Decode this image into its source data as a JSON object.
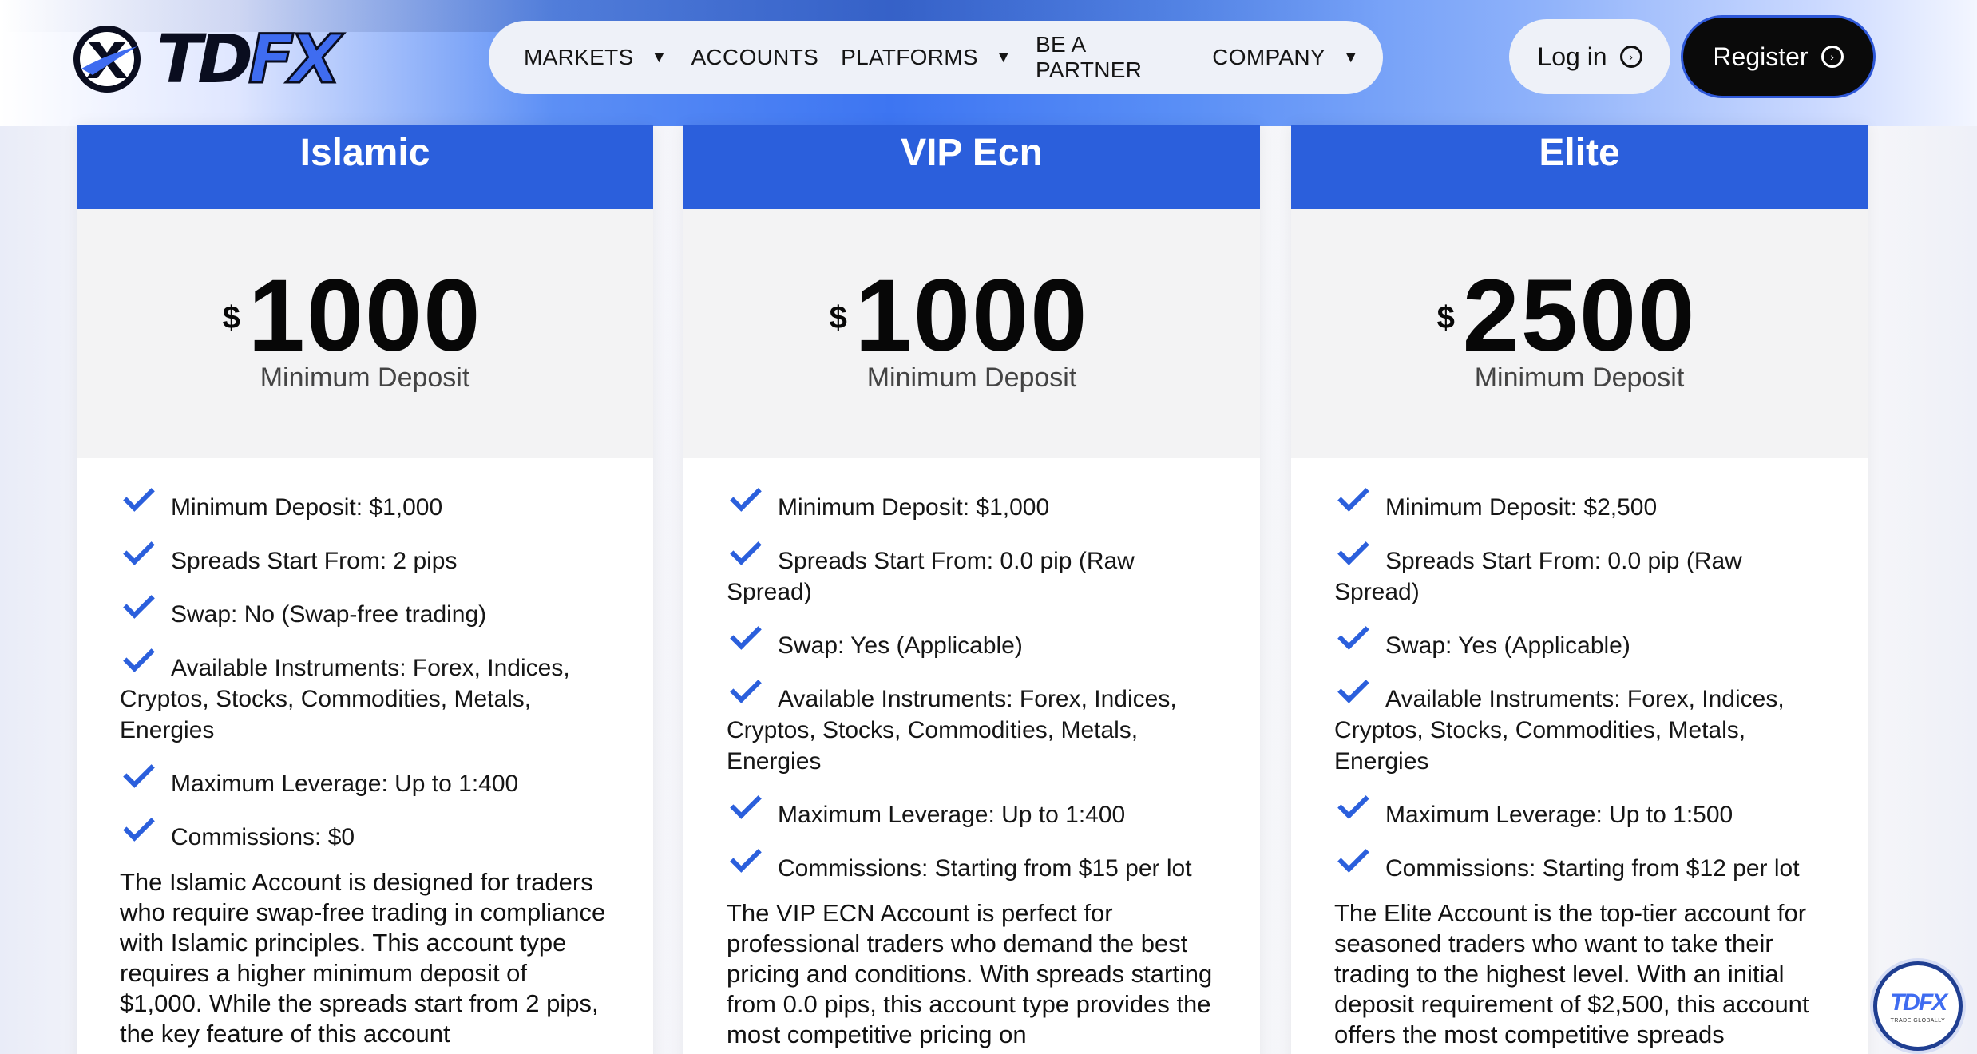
{
  "brand": {
    "logo_text_part1": "TD",
    "logo_text_part2": "FX",
    "accent_color": "#2b5fdc",
    "badge_sub": "TRADE GLOBALLY"
  },
  "nav": {
    "items": [
      {
        "label": "MARKETS",
        "has_dropdown": true
      },
      {
        "label": "ACCOUNTS",
        "has_dropdown": false
      },
      {
        "label": "PLATFORMS",
        "has_dropdown": true
      },
      {
        "label": "BE A PARTNER",
        "has_dropdown": false
      },
      {
        "label": "COMPANY",
        "has_dropdown": true
      }
    ],
    "login_label": "Log in",
    "register_label": "Register"
  },
  "cards": [
    {
      "title": "Islamic",
      "currency": "$",
      "amount": "1000",
      "amount_label": "Minimum Deposit",
      "features": [
        "Minimum Deposit: $1,000",
        "Spreads Start From: 2 pips",
        "Swap: No (Swap-free trading)",
        "Available Instruments: Forex, Indices, Cryptos, Stocks, Commodities, Metals, Energies",
        "Maximum Leverage: Up to 1:400",
        "Commissions: $0"
      ],
      "description": "The Islamic Account is designed for traders who require swap-free trading in compliance with Islamic principles. This account type requires a higher minimum deposit of $1,000. While the spreads start from 2 pips, the key feature of this account"
    },
    {
      "title": "VIP Ecn",
      "currency": "$",
      "amount": "1000",
      "amount_label": "Minimum Deposit",
      "features": [
        "Minimum Deposit: $1,000",
        "Spreads Start From: 0.0 pip (Raw Spread)",
        "Swap: Yes (Applicable)",
        "Available Instruments: Forex, Indices, Cryptos, Stocks, Commodities, Metals, Energies",
        "Maximum Leverage: Up to 1:400",
        "Commissions: Starting from $15 per lot"
      ],
      "description": "The VIP ECN Account is perfect for professional traders who demand the best pricing and conditions. With spreads starting from 0.0 pips, this account type provides the most competitive pricing on"
    },
    {
      "title": "Elite",
      "currency": "$",
      "amount": "2500",
      "amount_label": "Minimum Deposit",
      "features": [
        "Minimum Deposit: $2,500",
        "Spreads Start From: 0.0 pip (Raw Spread)",
        "Swap: Yes (Applicable)",
        "Available Instruments: Forex, Indices, Cryptos, Stocks, Commodities, Metals, Energies",
        "Maximum Leverage: Up to 1:500",
        "Commissions: Starting from $12 per lot"
      ],
      "description": "The Elite Account is the top-tier account for seasoned traders who want to take their trading to the highest level. With an initial deposit requirement of $2,500, this account offers the most competitive spreads"
    }
  ]
}
